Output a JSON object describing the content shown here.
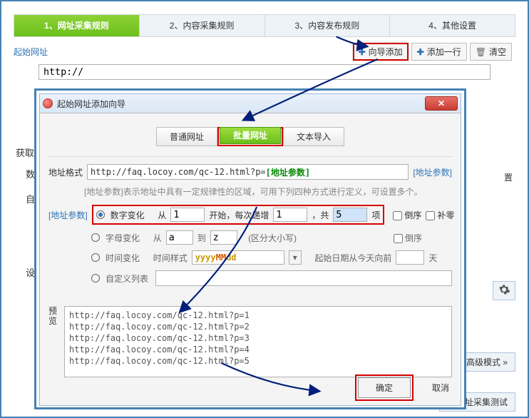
{
  "steps": {
    "s1": "1、网址采集规则",
    "s2": "2、内容采集规则",
    "s3": "3、内容发布规则",
    "s4": "4、其他设置"
  },
  "labels": {
    "start_url": "起始网址",
    "wizard_add": "向导添加",
    "add_row": "添加一行",
    "clear": "清空",
    "get": "获取",
    "self": "自",
    "set": "设",
    "config_short": "置",
    "num_short": "数"
  },
  "start_input": {
    "value": "http://"
  },
  "dialog": {
    "title": "起始网址添加向导",
    "tabs": {
      "t1": "普通网址",
      "t2": "批量网址",
      "t3": "文本导入"
    },
    "format_label": "地址格式",
    "format_value_prefix": "http://faq.locoy.com/qc-12.html?p=",
    "format_param": "[地址参数]",
    "format_link": "[地址参数]",
    "hint": "[地址参数]表示地址中具有一定规律性的区域，可用下列四种方式进行定义，可设置多个。",
    "param_label": "[地址参数]",
    "opt_number": "数字变化",
    "from_label": "从",
    "from_val": "1",
    "start_label": "开始，每次递增",
    "step_val": "1",
    "total_label": "，共",
    "total_val": "5",
    "unit": "项",
    "reverse": "倒序",
    "pad_zero": "补零",
    "opt_letter": "字母变化",
    "letter_from": "从",
    "letter_a": "a",
    "letter_to": "到",
    "letter_z": "z",
    "case_note": "(区分大小写)",
    "opt_time": "时间变化",
    "time_fmt_label": "时间样式",
    "time_fmt_y": "yyyy",
    "time_fmt_m": "MM",
    "time_fmt_d": "dd",
    "time_start_label": "起始日期从今天向前",
    "day_unit": "天",
    "opt_custom": "自定义列表",
    "preview_label": "预\n览",
    "preview_lines": {
      "l1": "http://faq.locoy.com/qc-12.html?p=1",
      "l2": "http://faq.locoy.com/qc-12.html?p=2",
      "l3": "http://faq.locoy.com/qc-12.html?p=3",
      "l4": "http://faq.locoy.com/qc-12.html?p=4",
      "l5": "http://faq.locoy.com/qc-12.html?p=5"
    },
    "ok": "确定",
    "cancel": "取消"
  },
  "right": {
    "advanced": "高级模式 »",
    "test": "网址采集测试"
  }
}
